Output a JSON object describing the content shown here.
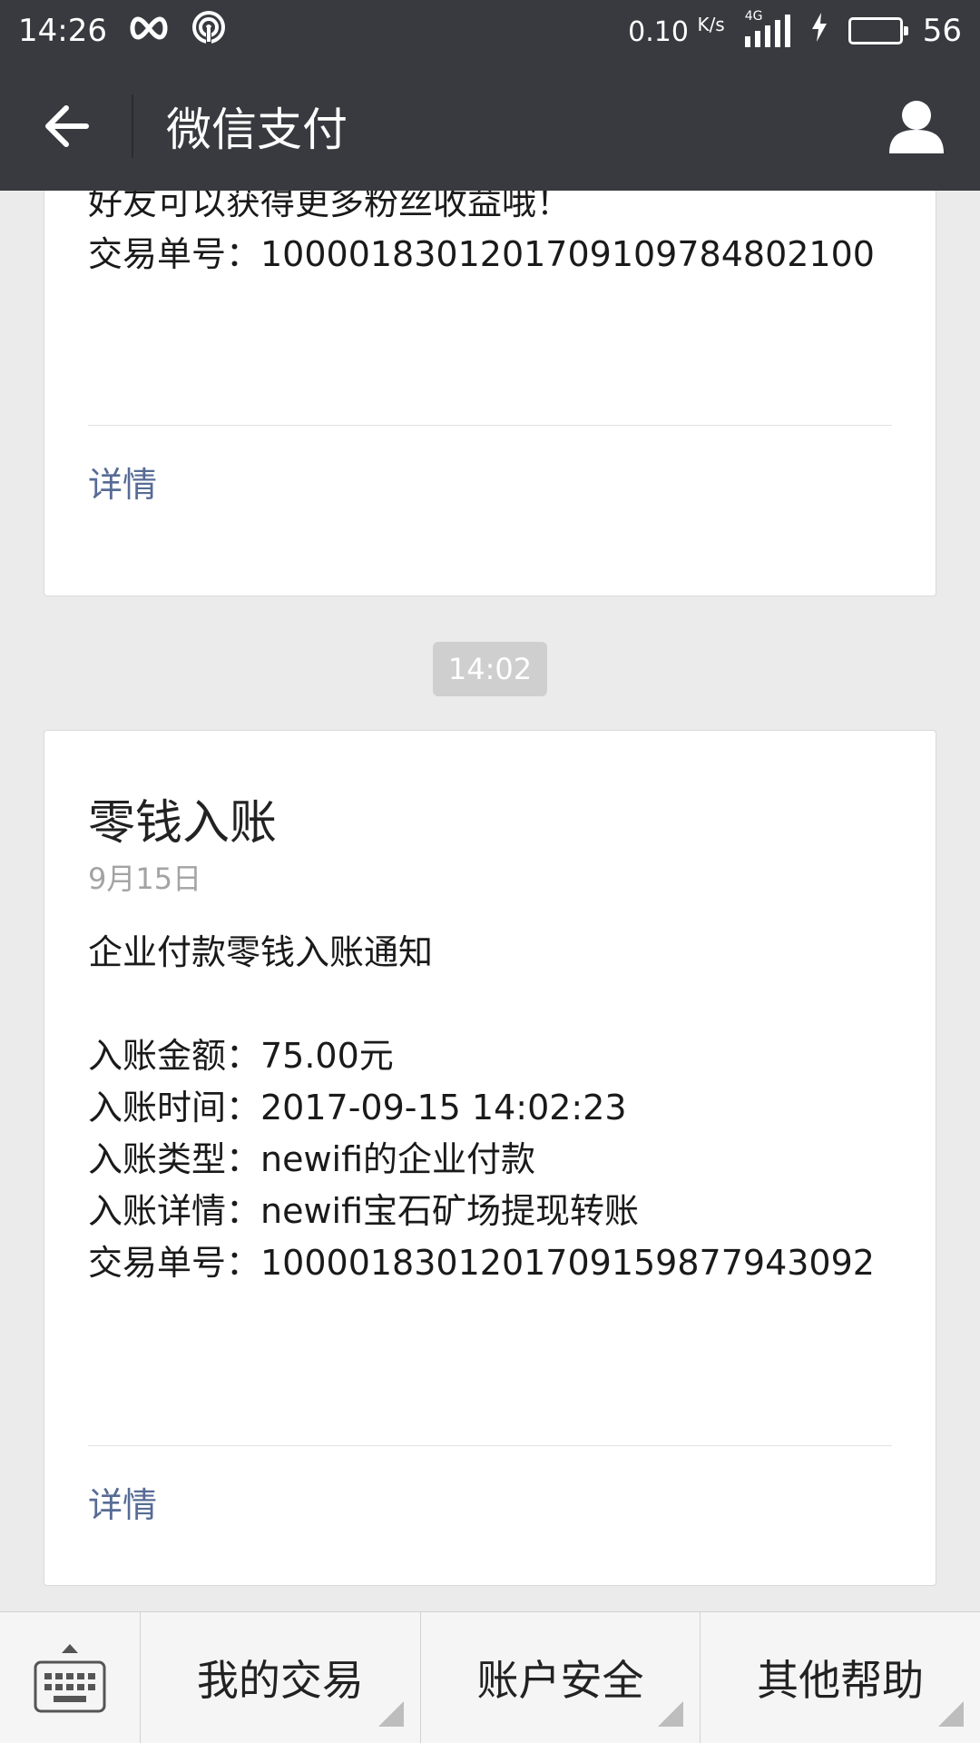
{
  "status_bar": {
    "time": "14:26",
    "net_speed": "0.10",
    "net_unit": "K/s",
    "network_type": "4G",
    "battery_level": "56",
    "battery_fraction": 0.95
  },
  "header": {
    "title": "微信支付",
    "back_icon": "arrow-left-icon",
    "user_icon": "user-icon"
  },
  "messages": [
    {
      "lines": [
        "好友可以获得更多粉丝收益哦！",
        "交易单号：100001830120170910978480210​0"
      ],
      "detail_label": "详情"
    },
    {
      "timestamp": "14:02",
      "title": "零钱入账",
      "date": "9月15日",
      "intro": "企业付款零钱入账通知",
      "lines": [
        "入账金额：75.00元",
        "入账时间：2017-09-15 14:02:23",
        "入账类型：newifi的企业付款",
        "入账详情：newifi宝石矿场提现转账",
        "交易单号：1000018301201709159877943092"
      ],
      "detail_label": "详情"
    }
  ],
  "bottom_menu": {
    "keyboard_icon": "keyboard-icon",
    "items": [
      {
        "label": "我的交易"
      },
      {
        "label": "账户安全"
      },
      {
        "label": "其他帮助"
      }
    ]
  }
}
